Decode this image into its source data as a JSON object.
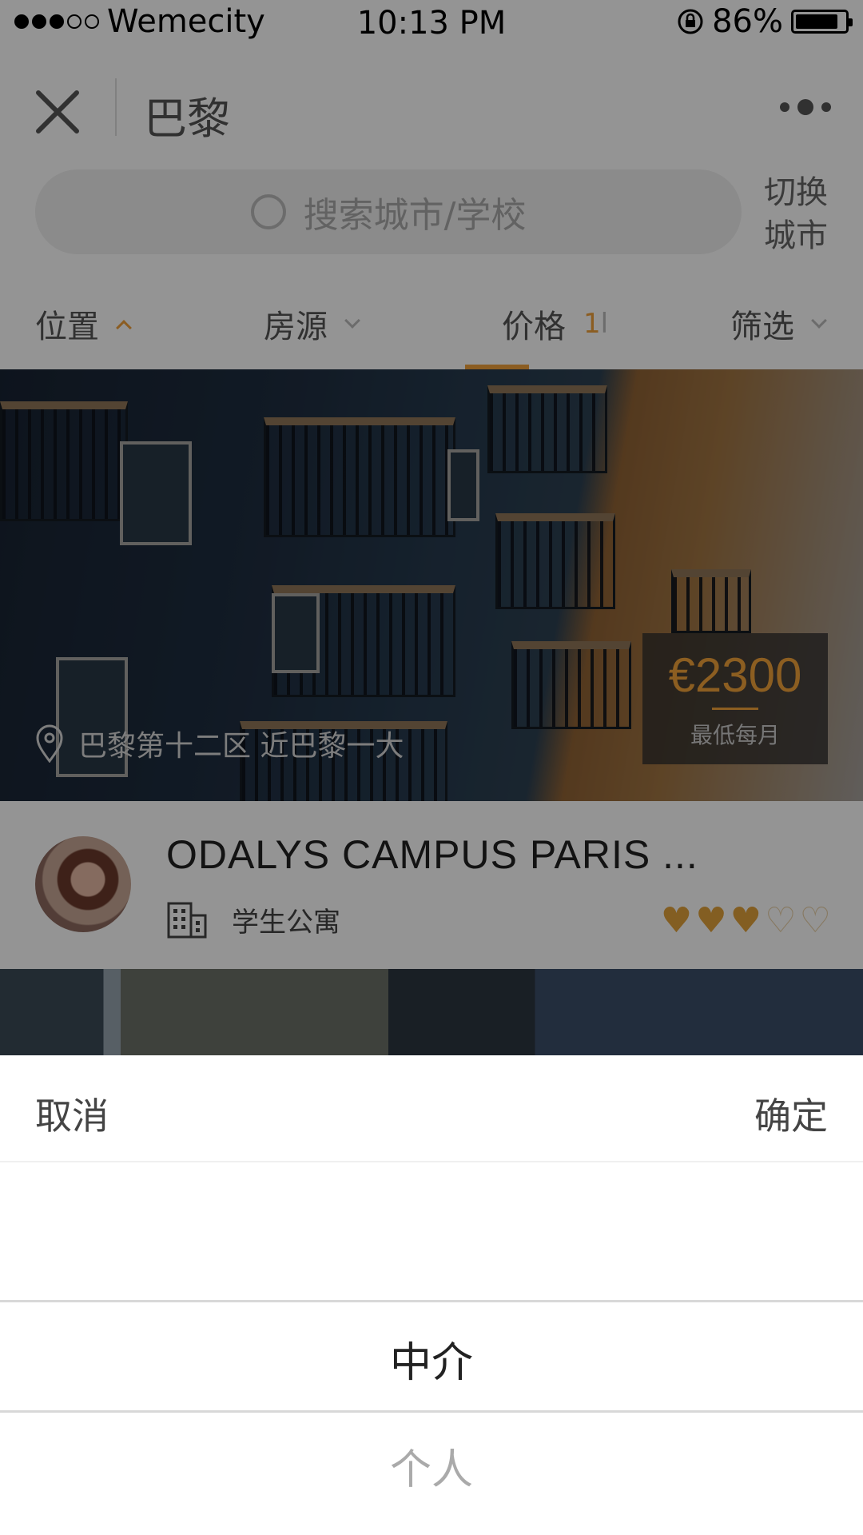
{
  "status_bar": {
    "carrier": "Wemecity",
    "time": "10:13 PM",
    "battery": "86%",
    "battery_level": 0.86
  },
  "nav": {
    "title": "巴黎"
  },
  "search": {
    "placeholder": "搜索城市/学校",
    "switch_city": "切换城市"
  },
  "filters": [
    {
      "label": "位置"
    },
    {
      "label": "房源"
    },
    {
      "label": "价格",
      "sort_glyph": "1",
      "sort_glyph2": "l"
    },
    {
      "label": "筛选"
    }
  ],
  "listing": {
    "location": "巴黎第十二区 近巴黎一大",
    "price": "€2300",
    "price_unit": "最低每月",
    "name": "ODALYS CAMPUS PARIS ...",
    "type": "学生公寓",
    "rating": 3,
    "rating_max": 5
  },
  "picker": {
    "cancel": "取消",
    "confirm": "确定",
    "options": [
      "中介",
      "个人"
    ],
    "selected": "中介"
  },
  "colors": {
    "accent": "#f0a03c"
  }
}
